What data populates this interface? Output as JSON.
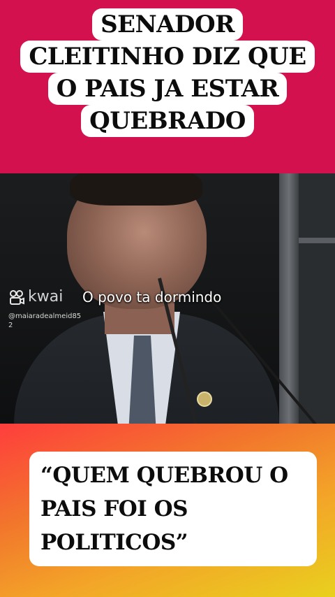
{
  "header": {
    "title_lines": [
      "SENADOR",
      "CLEITINHO DIZ QUE",
      "O PAIS JA ESTAR",
      "QUEBRADO"
    ],
    "background_color": "#d3114e"
  },
  "video": {
    "watermark": {
      "icon": "kwai-logo-icon",
      "brand": "kwai",
      "username": "@maiaradealmeid852"
    },
    "subtitle": "O povo ta dormindo"
  },
  "quote": {
    "lines": [
      "“QUEM QUEBROU O",
      "PAIS FOI OS",
      "POLITICOS”"
    ]
  }
}
